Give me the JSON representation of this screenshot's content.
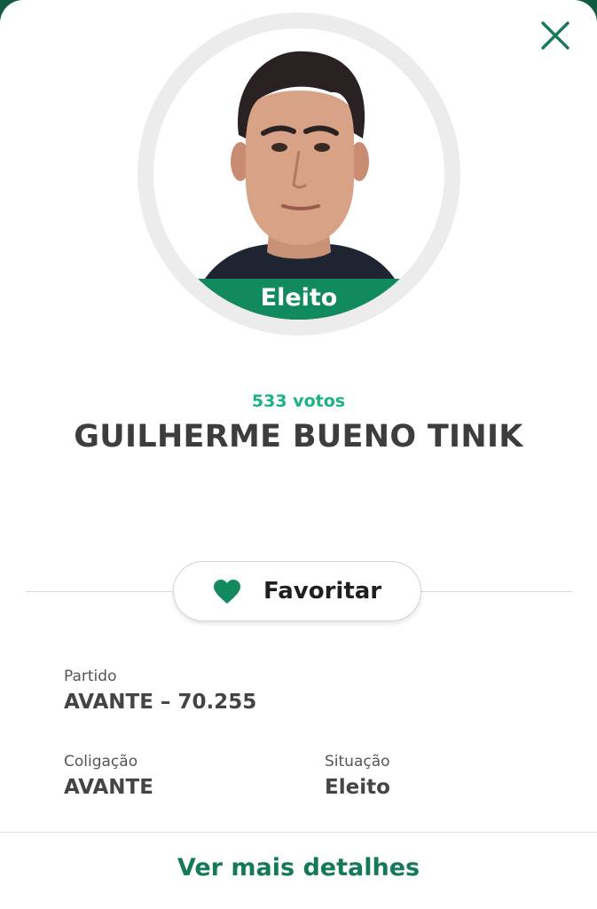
{
  "colors": {
    "accent_green": "#147a56",
    "votes_green": "#1bb37e",
    "banner_green": "#118a5d",
    "name_text": "#3d3d3d"
  },
  "header": {
    "close_icon": "close-x-icon"
  },
  "candidate": {
    "photo": "candidate-photo",
    "status_badge": "Eleito",
    "votes": "533 votos",
    "name": "GUILHERME BUENO TINIK"
  },
  "actions": {
    "favorite_label": "Favoritar",
    "favorite_icon": "heart-icon"
  },
  "info": {
    "party_label": "Partido",
    "party_value": "AVANTE – 70.255",
    "coalition_label": "Coligação",
    "coalition_value": "AVANTE",
    "situation_label": "Situação",
    "situation_value": "Eleito"
  },
  "footer": {
    "details_link": "Ver mais detalhes"
  }
}
